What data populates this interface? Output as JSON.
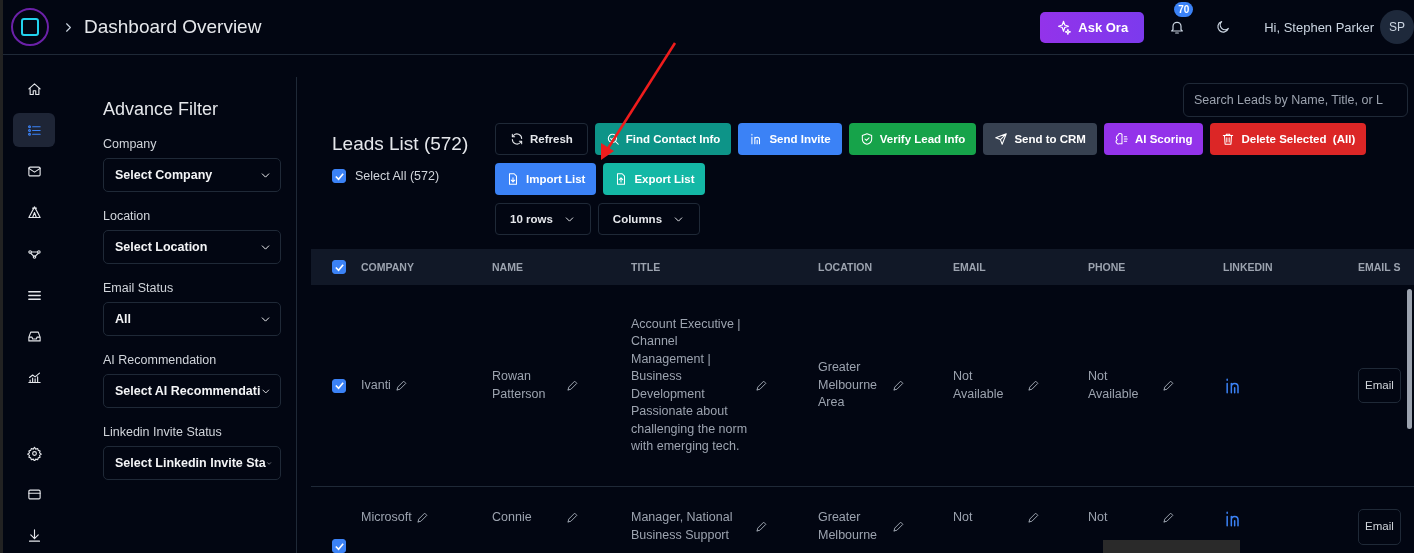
{
  "header": {
    "title": "Dashboard Overview",
    "ask_button": "Ask Ora",
    "notification_count": "70",
    "greeting": "Hi, Stephen Parker",
    "avatar": "SP"
  },
  "nav": {
    "main": [
      {
        "kind": "home",
        "selected": false
      },
      {
        "kind": "list",
        "selected": true
      },
      {
        "kind": "mail",
        "selected": false
      },
      {
        "kind": "tent",
        "selected": false
      },
      {
        "kind": "nodes",
        "selected": false
      },
      {
        "kind": "menu",
        "selected": false
      },
      {
        "kind": "inbox",
        "selected": false
      },
      {
        "kind": "chart",
        "selected": false
      }
    ],
    "bottom": [
      {
        "kind": "gear",
        "selected": false
      },
      {
        "kind": "card",
        "selected": false
      },
      {
        "kind": "download",
        "selected": false
      }
    ]
  },
  "filters": {
    "title": "Advance Filter",
    "fields": [
      {
        "label": "Company",
        "value": "Select Company"
      },
      {
        "label": "Location",
        "value": "Select Location"
      },
      {
        "label": "Email Status",
        "value": "All"
      },
      {
        "label": "AI Recommendation",
        "value": "Select AI Recommendati"
      },
      {
        "label": "Linkedin Invite Status",
        "value": "Select Linkedin Invite Sta"
      }
    ]
  },
  "leads": {
    "title": "Leads List (572)",
    "select_all": {
      "label": "Select All (572)",
      "checked": true
    },
    "search": {
      "placeholder": "Search Leads by Name, Title, or L"
    },
    "actions": [
      {
        "label": "Refresh",
        "kind": "refresh"
      },
      {
        "label": "Find Contact Info",
        "kind": "find",
        "color": "#0d9488"
      },
      {
        "label": "Send Invite",
        "kind": "linkedin",
        "color": "#3b82f6"
      },
      {
        "label": "Verify Lead Info",
        "kind": "shield",
        "color": "#16a34a"
      },
      {
        "label": "Send to CRM",
        "kind": "send",
        "color": "#374151"
      },
      {
        "label": "AI Scoring",
        "kind": "brain",
        "color": "#9333ea"
      },
      {
        "label": "Delete Selected  (All)",
        "kind": "trash",
        "color": "#dc2626"
      }
    ],
    "file_actions": [
      {
        "label": "Import List",
        "kind": "import",
        "color": "#3b82f6"
      },
      {
        "label": "Export List",
        "kind": "export",
        "color": "#14b8a6"
      }
    ],
    "view_controls": [
      {
        "label": "10 rows"
      },
      {
        "label": "Columns"
      }
    ]
  },
  "table": {
    "all_checked": true,
    "columns": [
      "COMPANY",
      "NAME",
      "TITLE",
      "LOCATION",
      "EMAIL",
      "PHONE",
      "LINKEDIN",
      "EMAIL S"
    ],
    "rows": [
      {
        "checked": true,
        "company": "Ivanti",
        "name": "Rowan Patterson",
        "title": "Account Executive | Channel Management | Business Development Passionate about challenging the norm with emerging tech.",
        "location": "Greater Melbourne Area",
        "email": "Not Available",
        "phone": "Not Available",
        "linkedin": true,
        "email_status": "Email"
      },
      {
        "checked": true,
        "company": "Microsoft",
        "name": "Connie",
        "title": "Manager, National Business Support",
        "location": "Greater Melbourne",
        "email": "Not",
        "phone": "Not",
        "linkedin": true,
        "email_status": "Email"
      }
    ]
  }
}
